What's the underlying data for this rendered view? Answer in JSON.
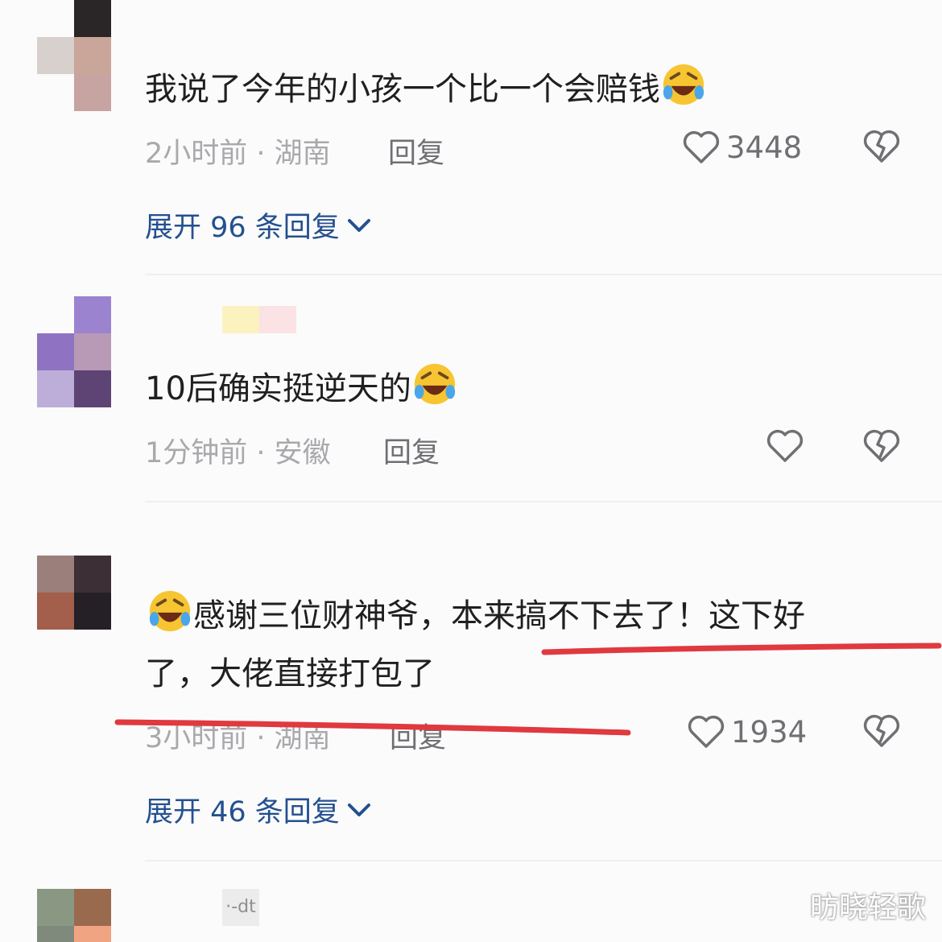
{
  "comments": [
    {
      "text": "我说了今年的小孩一个比一个会赔钱",
      "time_location": "2小时前 · 湖南",
      "reply_label": "回复",
      "likes": "3448",
      "expand_label": "展开 96 条回复"
    },
    {
      "text": "10后确实挺逆天的",
      "time_location": "1分钟前 · 安徽",
      "reply_label": "回复",
      "likes": ""
    },
    {
      "text_line1": "感谢三位财神爷，本来搞不下去了！这下好",
      "text_line2": "了，大佬直接打包了",
      "time_location": "3小时前 · 湖南",
      "reply_label": "回复",
      "likes": "1934",
      "expand_label": "展开 46 条回复"
    },
    {
      "username_fragment": "·-dt"
    }
  ],
  "watermark": "昉晓轻歌",
  "colors": {
    "link_blue": "#24508f",
    "meta_gray": "#a9a9ad",
    "underline_red": "#e0393e",
    "emoji_yellow": "#f7c531"
  },
  "icons": {
    "like": "heart-outline-icon",
    "dislike": "broken-heart-icon",
    "expand": "chevron-down-icon",
    "emoji": "rofl-laughing-emoji"
  }
}
